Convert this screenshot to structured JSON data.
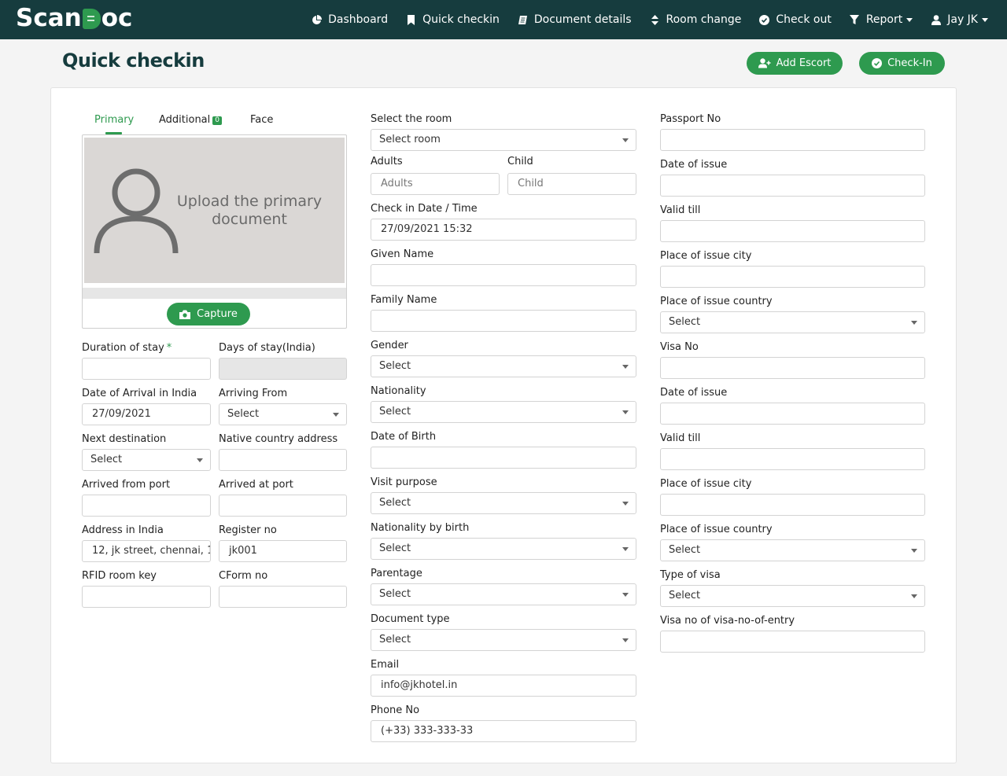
{
  "brand": {
    "logo_before": "Scan",
    "logo_after": "oc"
  },
  "nav": {
    "dashboard": "Dashboard",
    "quick_checkin": "Quick checkin",
    "document_details": "Document details",
    "room_change": "Room change",
    "check_out": "Check out",
    "report": "Report",
    "user": "Jay JK"
  },
  "page": {
    "title": "Quick checkin",
    "add_escort": "Add Escort",
    "check_in": "Check-In"
  },
  "tabs": {
    "primary": "Primary",
    "additional": "Additional",
    "additional_count": "0",
    "face": "Face"
  },
  "upload": {
    "text": "Upload the primary document",
    "capture": "Capture"
  },
  "left": {
    "duration_label": "Duration of stay",
    "duration_required": "*",
    "days_label": "Days of stay(India)",
    "arrival_date_label": "Date of Arrival in India",
    "arrival_date_value": "27/09/2021",
    "arriving_from_label": "Arriving From",
    "arriving_from_value": "Select",
    "next_dest_label": "Next destination",
    "next_dest_value": "Select",
    "native_addr_label": "Native country address",
    "arrived_from_port_label": "Arrived from port",
    "arrived_at_port_label": "Arrived at port",
    "address_india_label": "Address in India",
    "address_india_value": "12, jk street, chennai, 1",
    "register_label": "Register no",
    "register_value": "jk001",
    "rfid_label": "RFID room key",
    "cform_label": "CForm no"
  },
  "middle": {
    "room_label": "Select the room",
    "room_value": "Select room",
    "adults_label": "Adults",
    "adults_placeholder": "Adults",
    "child_label": "Child",
    "child_placeholder": "Child",
    "checkin_label": "Check in Date / Time",
    "checkin_value": "27/09/2021 15:32",
    "given_name_label": "Given Name",
    "family_name_label": "Family Name",
    "gender_label": "Gender",
    "gender_value": "Select",
    "nationality_label": "Nationality",
    "nationality_value": "Select",
    "dob_label": "Date of Birth",
    "visit_label": "Visit purpose",
    "visit_value": "Select",
    "nat_birth_label": "Nationality by birth",
    "nat_birth_value": "Select",
    "parentage_label": "Parentage",
    "parentage_value": "Select",
    "doctype_label": "Document type",
    "doctype_value": "Select",
    "email_label": "Email",
    "email_value": "info@jkhotel.in",
    "phone_label": "Phone No",
    "phone_value": "(+33) 333-333-33"
  },
  "right": {
    "passport_label": "Passport No",
    "p_issue_label": "Date of issue",
    "p_valid_label": "Valid till",
    "p_city_label": "Place of issue city",
    "p_country_label": "Place of issue country",
    "p_country_value": "Select",
    "visa_label": "Visa No",
    "v_issue_label": "Date of issue",
    "v_valid_label": "Valid till",
    "v_city_label": "Place of issue city",
    "v_country_label": "Place of issue country",
    "v_country_value": "Select",
    "visa_type_label": "Type of visa",
    "visa_type_value": "Select",
    "visa_entry_label": "Visa no of visa-no-of-entry"
  },
  "colors": {
    "navbar": "#163c3e",
    "accent": "#2e9a4f"
  }
}
